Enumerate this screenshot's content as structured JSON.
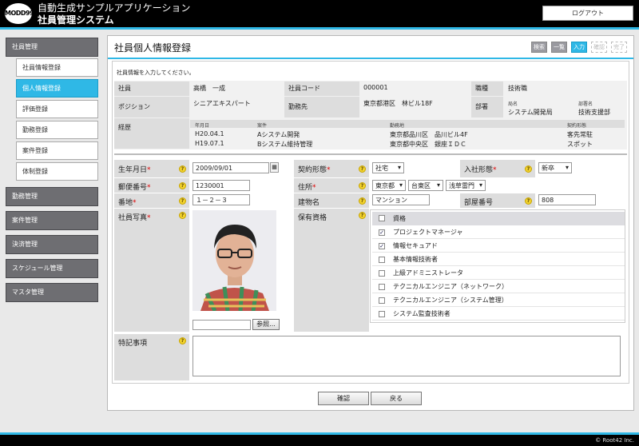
{
  "header": {
    "logo_text": "MODD99",
    "app_title": "自動生成サンプルアプリケーション",
    "app_subtitle": "社員管理システム",
    "logout_label": "ログアウト"
  },
  "sidebar": {
    "sections": [
      {
        "label": "社員管理"
      },
      {
        "label": "勤務管理"
      },
      {
        "label": "案件管理"
      },
      {
        "label": "決済管理"
      },
      {
        "label": "スケジュール管理"
      },
      {
        "label": "マスタ管理"
      }
    ],
    "sub_items": [
      {
        "label": "社員情報登録"
      },
      {
        "label": "個人情報登録"
      },
      {
        "label": "評価登録"
      },
      {
        "label": "勤務登録"
      },
      {
        "label": "案件登録"
      },
      {
        "label": "体制登録"
      }
    ]
  },
  "page": {
    "title": "社員個人情報登録",
    "modes": [
      "検索",
      "一覧",
      "入力",
      "確認",
      "完了"
    ],
    "intro": "社員情報を入力してください。"
  },
  "employee": {
    "label_employee": "社員",
    "name": "高橋　一成",
    "label_code": "社員コード",
    "code": "000001",
    "label_job": "職種",
    "job": "技術職",
    "label_position": "ポジション",
    "position": "シニアエキスパート",
    "label_workplace": "勤務先",
    "workplace": "東京都港区　林ビル18F",
    "label_dept": "部署",
    "dept_head_1": "局名",
    "dept_head_2": "部署名",
    "dept_val_1": "システム開発局",
    "dept_val_2": "技術支援部",
    "label_history": "経歴",
    "history_headers": [
      "年月日",
      "案件",
      "勤務地",
      "契約形態"
    ],
    "history_rows": [
      [
        "H20.04.1",
        "Aシステム開発",
        "東京都品川区　品川ビル4F",
        "客先常駐"
      ],
      [
        "H19.07.1",
        "Bシステム維持管理",
        "東京都中央区　銀座ＩＤＣ",
        "スポット"
      ]
    ]
  },
  "form": {
    "birth_label": "生年月日",
    "birth_value": "2009/09/01",
    "contract_label": "契約形態",
    "contract_value": "社宅",
    "entry_label": "入社形態",
    "entry_value": "新卒",
    "zip_label": "郵便番号",
    "zip_value": "1230001",
    "address_label": "住所",
    "pref_value": "東京都",
    "city_value": "台東区",
    "town_value": "浅草雷門",
    "banchi_label": "番地",
    "banchi_value": "１－２－３",
    "building_label": "建物名",
    "building_value": "マンション",
    "room_label": "部屋番号",
    "room_value": "808",
    "photo_label": "社員写真",
    "browse_label": "参照...",
    "qual_label": "保有資格",
    "qual_header": "資格",
    "quals": [
      {
        "label": "プロジェクトマネージャ",
        "checked": true
      },
      {
        "label": "情報セキュアド",
        "checked": true
      },
      {
        "label": "基本情報技術者",
        "checked": false
      },
      {
        "label": "上級アドミニストレータ",
        "checked": false
      },
      {
        "label": "テクニカルエンジニア（ネットワーク）",
        "checked": false
      },
      {
        "label": "テクニカルエンジニア（システム管理）",
        "checked": false
      },
      {
        "label": "システム監査技術者",
        "checked": false
      }
    ],
    "notes_label": "特記事項",
    "required_mark": "*",
    "help_mark": "?"
  },
  "actions": {
    "confirm_label": "確認",
    "back_label": "戻る"
  },
  "footer": {
    "copyright": "© Root42 Inc."
  },
  "colors": {
    "accent": "#2fb8e6",
    "sidebar": "#6e6e72",
    "label_bg": "#dddddd"
  }
}
